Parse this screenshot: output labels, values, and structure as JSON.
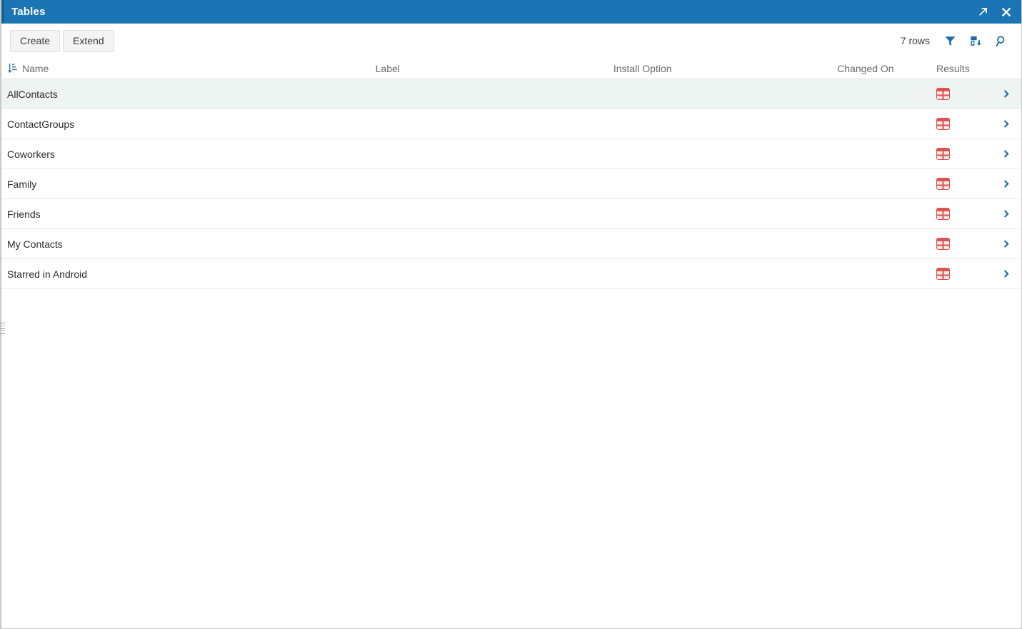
{
  "window": {
    "title": "Tables",
    "accent_color": "#1b75b4",
    "titlebar_actions": [
      {
        "name": "open-in-new-icon",
        "label": "Open in new window"
      },
      {
        "name": "close-icon",
        "label": "Close"
      }
    ]
  },
  "toolbar": {
    "create_label": "Create",
    "extend_label": "Extend",
    "row_count": "7 rows",
    "icons": [
      {
        "name": "filter-icon",
        "label": "Filter"
      },
      {
        "name": "save-icon",
        "label": "Save"
      },
      {
        "name": "search-icon",
        "label": "Search"
      }
    ]
  },
  "table": {
    "sort_icon": "sort-ascending-icon",
    "columns": [
      {
        "key": "name",
        "label": "Name"
      },
      {
        "key": "label",
        "label": "Label"
      },
      {
        "key": "install_option",
        "label": "Install Option"
      },
      {
        "key": "changed_on",
        "label": "Changed On"
      },
      {
        "key": "results",
        "label": "Results"
      }
    ],
    "results_icon_color": "#d9534f",
    "chevron_color": "#1f6ba5",
    "selected_row_index": 0,
    "rows": [
      {
        "name": "AllContacts",
        "label": "",
        "install_option": "",
        "changed_on": "",
        "results_icon": "table-icon",
        "detail_icon": "chevron-right-icon"
      },
      {
        "name": "ContactGroups",
        "label": "",
        "install_option": "",
        "changed_on": "",
        "results_icon": "table-icon",
        "detail_icon": "chevron-right-icon"
      },
      {
        "name": "Coworkers",
        "label": "",
        "install_option": "",
        "changed_on": "",
        "results_icon": "table-icon",
        "detail_icon": "chevron-right-icon"
      },
      {
        "name": "Family",
        "label": "",
        "install_option": "",
        "changed_on": "",
        "results_icon": "table-icon",
        "detail_icon": "chevron-right-icon"
      },
      {
        "name": "Friends",
        "label": "",
        "install_option": "",
        "changed_on": "",
        "results_icon": "table-icon",
        "detail_icon": "chevron-right-icon"
      },
      {
        "name": "My Contacts",
        "label": "",
        "install_option": "",
        "changed_on": "",
        "results_icon": "table-icon",
        "detail_icon": "chevron-right-icon"
      },
      {
        "name": "Starred in Android",
        "label": "",
        "install_option": "",
        "changed_on": "",
        "results_icon": "table-icon",
        "detail_icon": "chevron-right-icon"
      }
    ]
  }
}
